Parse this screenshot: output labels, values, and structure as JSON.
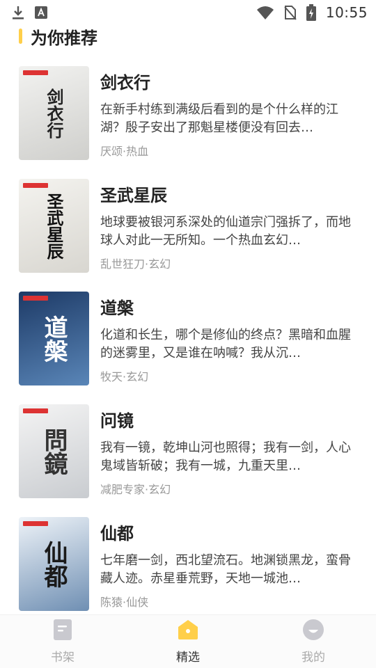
{
  "status_bar": {
    "time": "10:55",
    "left_icons": [
      "download-icon",
      "a-badge-icon"
    ],
    "right_icons": [
      "wifi-icon",
      "no-sim-icon",
      "battery-charging-icon"
    ]
  },
  "section": {
    "title": "为你推荐"
  },
  "books": [
    {
      "title": "剑衣行",
      "desc": "在新手村练到满级后看到的是个什么样的江湖？殷子安出了那魁星楼便没有回去…",
      "meta": "厌颂·热血",
      "cover_text": "剑衣行",
      "cover_colors": [
        "#f2f2f0",
        "#cfcfcc"
      ],
      "cover_ink": "#222222"
    },
    {
      "title": "圣武星辰",
      "desc": "地球要被银河系深处的仙道宗门强拆了，而地球人对此一无所知。一个热血玄幻…",
      "meta": "乱世狂刀·玄幻",
      "cover_text": "圣武星辰",
      "cover_colors": [
        "#f4f3ef",
        "#d8d6d0"
      ],
      "cover_ink": "#111111"
    },
    {
      "title": "道槃",
      "desc": "化道和长生，哪个是修仙的终点？黑暗和血腥的迷雾里，又是谁在呐喊？我从沉…",
      "meta": "牧天·玄幻",
      "cover_text": "道槃",
      "cover_colors": [
        "#1d3a66",
        "#5a86b8"
      ],
      "cover_ink": "#ffffff"
    },
    {
      "title": "问镜",
      "desc": "我有一镜，乾坤山河也照得；我有一剑，人心鬼域皆斩破；我有一城，九重天里…",
      "meta": "减肥专家·玄幻",
      "cover_text": "問鏡",
      "cover_colors": [
        "#f4f4f4",
        "#c9ccd0"
      ],
      "cover_ink": "#333333"
    },
    {
      "title": "仙都",
      "desc": "七年磨一剑，西北望流石。地渊锁黑龙，蛮骨藏人迹。赤星垂荒野，天地一城池…",
      "meta": "陈猿·仙侠",
      "cover_text": "仙都",
      "cover_colors": [
        "#eef3f8",
        "#6f8fb3"
      ],
      "cover_ink": "#1a1a1a"
    }
  ],
  "tabs": [
    {
      "label": "书架",
      "icon": "bookshelf-icon",
      "active": false
    },
    {
      "label": "精选",
      "icon": "featured-home-icon",
      "active": true
    },
    {
      "label": "我的",
      "icon": "profile-icon",
      "active": false
    }
  ],
  "colors": {
    "accent": "#ffcf4a",
    "inactive": "#c9c9cf"
  }
}
